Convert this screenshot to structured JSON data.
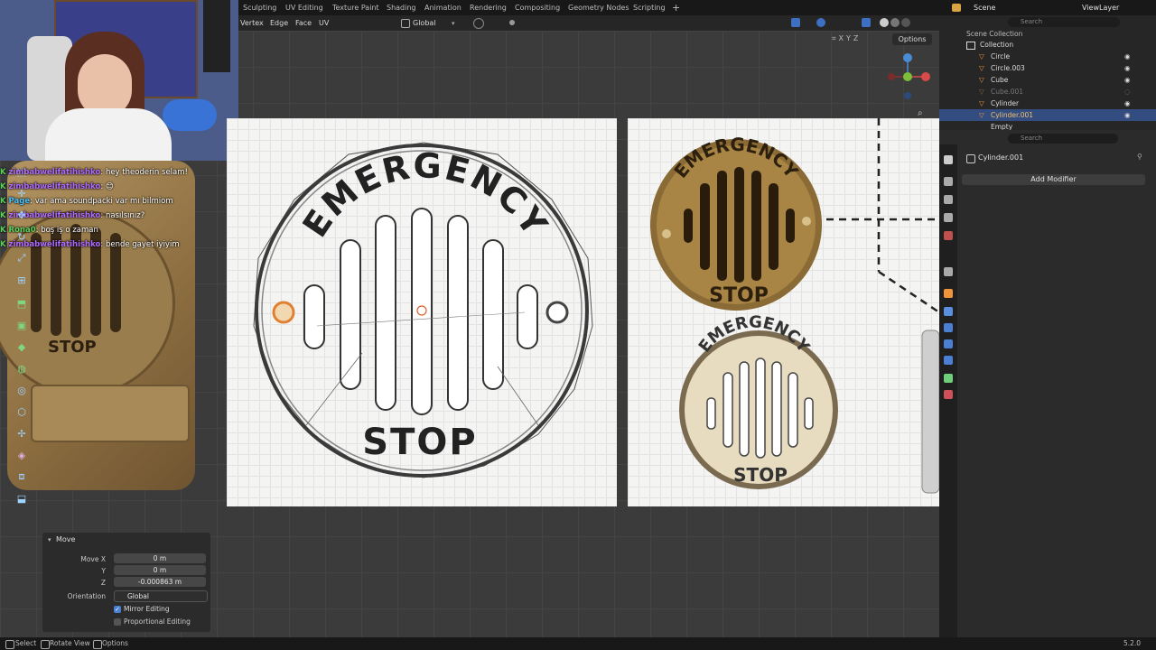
{
  "workspace_tabs": [
    "Sculpting",
    "UV Editing",
    "Texture Paint",
    "Shading",
    "Animation",
    "Rendering",
    "Compositing",
    "Geometry Nodes",
    "Scripting"
  ],
  "add_tab": "+",
  "scene_label": "Scene",
  "viewlayer_label": "ViewLayer",
  "header": {
    "select_modes": [
      "Vertex",
      "Edge",
      "Face",
      "UV"
    ],
    "orientation": "Global",
    "options": "Options"
  },
  "chat": [
    {
      "user": "zimbabwelifatihishko",
      "msg": ": hey theoderin selam!"
    },
    {
      "user": "zimbabwelifatihishko",
      "msg": ": 😊"
    },
    {
      "user": "Page",
      "msg": ": var ama soundpacki var mı bilmiom"
    },
    {
      "user": "zimbabwelifatihishko",
      "msg": ": nasılsınız?"
    },
    {
      "user": "Rona0",
      "msg": ": boş iş o zaman"
    },
    {
      "user": "zimbabwelifatihishko",
      "msg": ": bende gayet iyiyim"
    }
  ],
  "sign": {
    "top_text": "EMERGENCY",
    "bottom_text": "STOP"
  },
  "plaque_text": "STOP",
  "move_panel": {
    "title": "Move",
    "move_x_label": "Move X",
    "move_x": "0 m",
    "y_label": "Y",
    "y": "0 m",
    "z_label": "Z",
    "z": "-0.000863 m",
    "orientation_label": "Orientation",
    "orientation": "Global",
    "mirror_editing": "Mirror Editing",
    "proportional_editing": "Proportional Editing"
  },
  "status": {
    "select": "Select",
    "rotate_view": "Rotate View",
    "options": "Options",
    "version": "5.2.0"
  },
  "outliner": {
    "search_placeholder": "Search",
    "scene_collection": "Scene Collection",
    "collection": "Collection",
    "items": [
      "Circle",
      "Circle.003",
      "Cube",
      "Cube.001",
      "Cylinder",
      "Cylinder.001",
      "Empty"
    ]
  },
  "properties": {
    "search_placeholder": "Search",
    "object_name": "Cylinder.001",
    "add_modifier": "Add Modifier"
  }
}
